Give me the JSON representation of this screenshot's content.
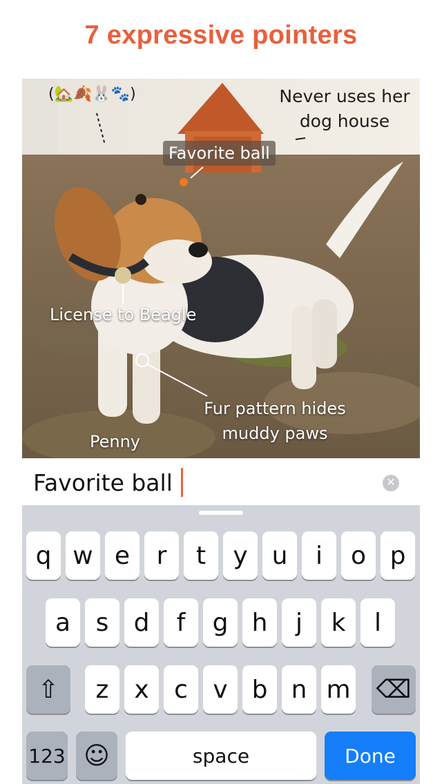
{
  "headline": "7 expressive pointers",
  "photo": {
    "annotations": {
      "emoji_row": "(🏡🍂🐰🐾)",
      "dog_house": "Never uses her dog house",
      "favorite_ball": "Favorite ball",
      "license": "License to Beagle",
      "fur": "Fur pattern hides muddy paws",
      "name": "Penny"
    }
  },
  "text_field": {
    "value": "Favorite ball",
    "clear_glyph": "✕"
  },
  "keyboard": {
    "row1": [
      "q",
      "w",
      "e",
      "r",
      "t",
      "y",
      "u",
      "i",
      "o",
      "p"
    ],
    "row2": [
      "a",
      "s",
      "d",
      "f",
      "g",
      "h",
      "j",
      "k",
      "l"
    ],
    "row3": [
      "z",
      "x",
      "c",
      "v",
      "b",
      "n",
      "m"
    ],
    "shift_glyph": "⇧",
    "delete_glyph": "⌫",
    "numbers_label": "123",
    "emoji_glyph": "☺",
    "space_label": "space",
    "done_label": "Done",
    "done_color": "#147efb"
  },
  "colors": {
    "accent": "#e8603c"
  }
}
